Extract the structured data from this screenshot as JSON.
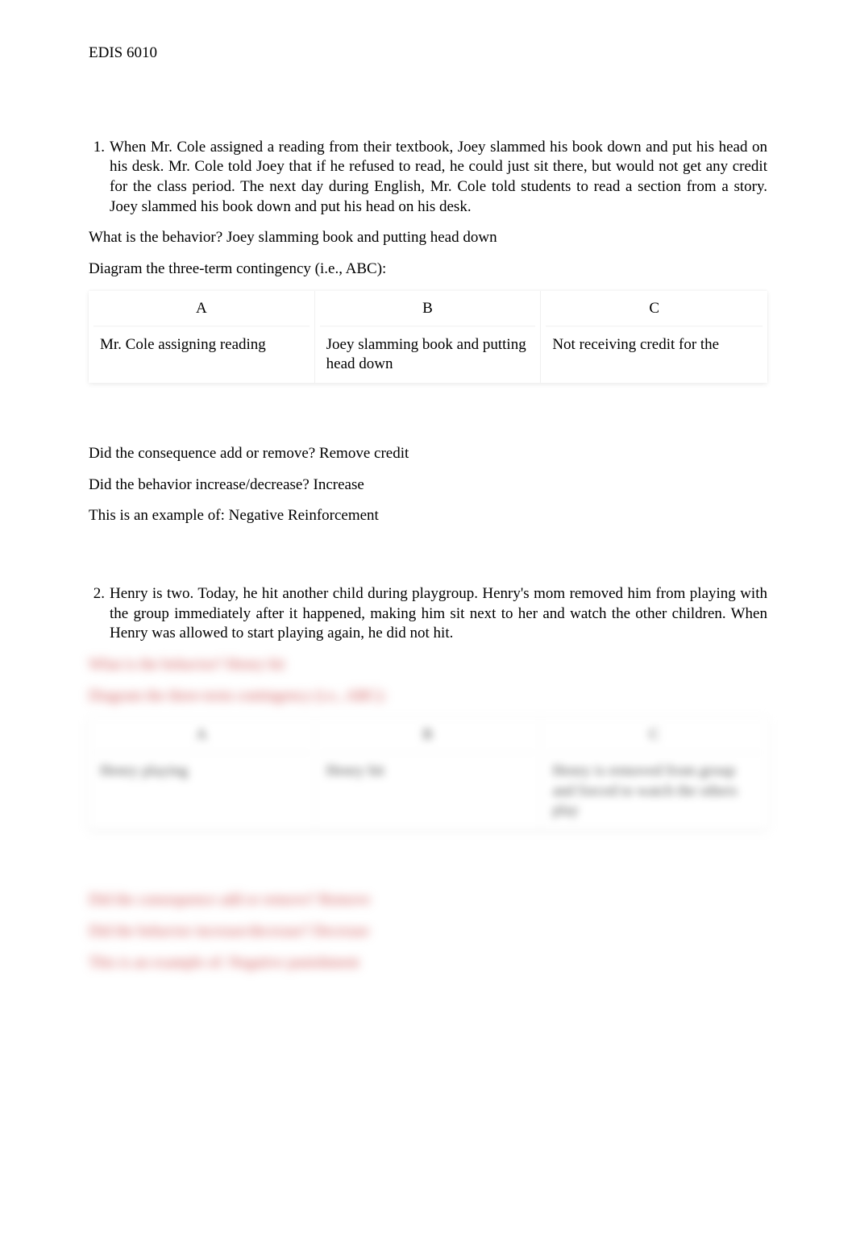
{
  "header": {
    "course": "EDIS 6010"
  },
  "q1": {
    "number": "1.",
    "prompt": "When Mr. Cole assigned a reading from their textbook, Joey slammed his book down and put his head on his desk. Mr. Cole told Joey that if he refused to read, he could just sit there, but would not get any credit for the class period. The next day during English, Mr. Cole told students to read a section from a story. Joey slammed his book down and put his head on his desk.",
    "behavior_label": "What is the behavior? ",
    "behavior_answer": "Joey slamming book and putting head down",
    "diagram_label": "Diagram the three-term contingency (i.e., ABC):",
    "table": {
      "headers": {
        "a": "A",
        "b": "B",
        "c": "C"
      },
      "row": {
        "a": "Mr. Cole assigning reading",
        "b": "Joey slamming book and putting head down",
        "c": "Not receiving credit for the"
      }
    },
    "consequence_label": "Did the consequence add or remove? ",
    "consequence_answer": "Remove credit",
    "change_label": "Did the behavior increase/decrease? ",
    "change_answer": "Increase",
    "example_label": "This is an example of: ",
    "example_answer": "Negative Reinforcement"
  },
  "q2": {
    "number": "2.",
    "prompt": "Henry is two. Today, he hit another child during playgroup. Henry's mom removed him from playing with the group immediately after it happened, making him sit next to her and watch the other children. When Henry was allowed to start playing again, he did not hit.",
    "behavior_label": "What is the behavior? ",
    "behavior_answer": "Henry hit",
    "diagram_label": "Diagram the three-term contingency (i.e., ABC):",
    "table": {
      "headers": {
        "a": "A",
        "b": "B",
        "c": "C"
      },
      "row": {
        "a": "Henry playing",
        "b": "Henry hit",
        "c": "Henry is removed from group and forced to watch the others play"
      }
    },
    "consequence_label": "Did the consequence add or remove? ",
    "consequence_answer": "Remove",
    "change_label": "Did the behavior increase/decrease? ",
    "change_answer": "Decrease",
    "example_label": "This is an example of: ",
    "example_answer": "Negative punishment"
  }
}
